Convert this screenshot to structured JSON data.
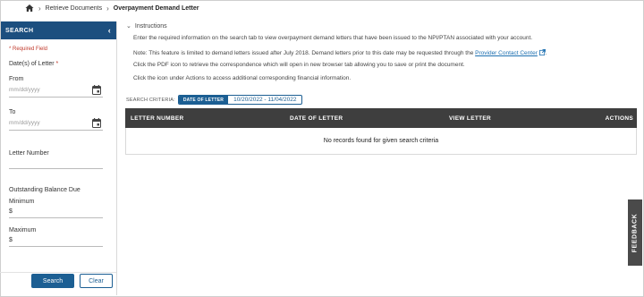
{
  "breadcrumb": {
    "items": [
      "Retrieve Documents",
      "Overpayment Demand Letter"
    ]
  },
  "sidebar": {
    "title": "SEARCH",
    "required_note": "* Required Field",
    "date_label": "Date(s) of Letter",
    "required_star": "*",
    "from_label": "From",
    "from_placeholder": "mm/dd/yyyy",
    "to_label": "To",
    "to_placeholder": "mm/dd/yyyy",
    "letter_number_label": "Letter Number",
    "balance_label": "Outstanding Balance Due",
    "minimum_label": "Minimum",
    "minimum_value": "$",
    "maximum_label": "Maximum",
    "maximum_value": "$",
    "search_button": "Search",
    "clear_button": "Clear"
  },
  "instructions": {
    "toggle_label": "Instructions",
    "line1": "Enter the required information on the search tab to view overpayment demand letters that have been issued to the NPI/PTAN associated with your account.",
    "line2_prefix": "Note: This feature is limited to demand letters issued after July 2018. Demand letters prior to this date may be requested through the ",
    "line2_link": "Provider Contact Center",
    "line2_suffix": ".",
    "line3": "Click the PDF icon to retrieve the correspondence which will open in new browser tab allowing you to save or print the document.",
    "line4": "Click the icon under Actions to access additional corresponding financial information."
  },
  "criteria": {
    "label": "SEARCH CRITERIA:",
    "tag": "DATE OF LETTER",
    "value": "10/20/2022 - 11/04/2022"
  },
  "table": {
    "columns": [
      "LETTER NUMBER",
      "DATE OF LETTER",
      "VIEW LETTER",
      "ACTIONS"
    ],
    "empty_message": "No records found for given search criteria"
  },
  "feedback_label": "FEEDBACK",
  "colors": {
    "accent": "#1c5f93",
    "header_dark": "#3e3e3e",
    "required": "#c0392b",
    "link": "#1c6fb0"
  }
}
